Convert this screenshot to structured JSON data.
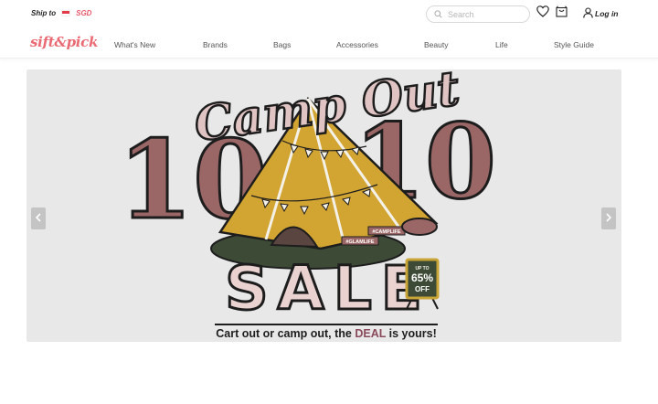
{
  "header": {
    "ship_to_label": "Ship to",
    "currency": "SGD",
    "search_placeholder": "Search",
    "login_label": "Log in"
  },
  "logo": {
    "text": "sift&pick"
  },
  "nav": {
    "items": [
      "What's New",
      "Brands",
      "Bags",
      "Accessories",
      "Beauty",
      "Life",
      "Style Guide"
    ]
  },
  "banner": {
    "headline": "Camp Out",
    "number_left": "10",
    "number_right": "10",
    "sale_text": "SALE",
    "badge_small": "UP TO",
    "badge_big": "65%",
    "badge_off": "OFF",
    "tag_1": "#GLAMLIFE",
    "tag_2": "#CAMPLIFE",
    "tagline_before": "Cart out or camp out, the ",
    "tagline_deal": "DEAL",
    "tagline_after": " is yours!"
  },
  "colors": {
    "accent": "#ea6a73",
    "mauve": "#9a6766",
    "mustard": "#d2a432",
    "dark_green": "#3d4a36",
    "banner_bg": "#e8e8e8",
    "deal": "#8a4a5c"
  },
  "icons": {
    "search": "search-icon",
    "wishlist": "heart-icon",
    "cart": "bag-icon",
    "user": "user-icon",
    "prev": "chevron-left-icon",
    "next": "chevron-right-icon"
  }
}
